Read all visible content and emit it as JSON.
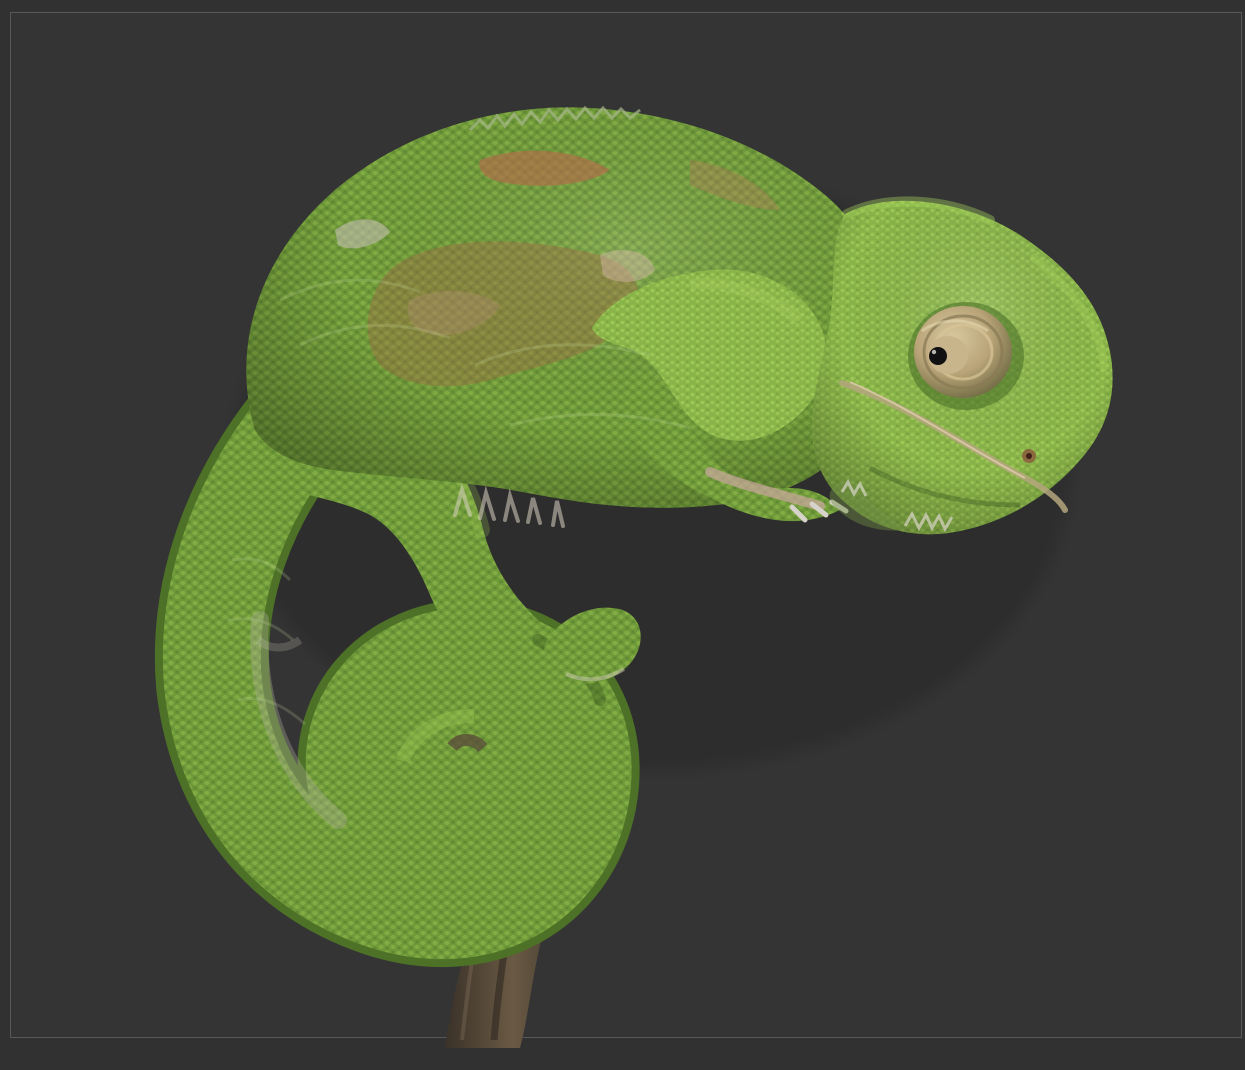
{
  "scene": {
    "background": "#333333",
    "frame_color": "#585858",
    "subject": "chameleon",
    "palette": {
      "body_green": "#6f9a3a",
      "body_light": "#8fbf45",
      "body_shadow": "#3f5d22",
      "rust_patch": "#a86a48",
      "pale_patch": "#b7b0a0",
      "eye_ring": "#c7b289",
      "pupil": "#111111",
      "branch": "#6a5a44",
      "branch_shadow": "#3f3429"
    }
  }
}
